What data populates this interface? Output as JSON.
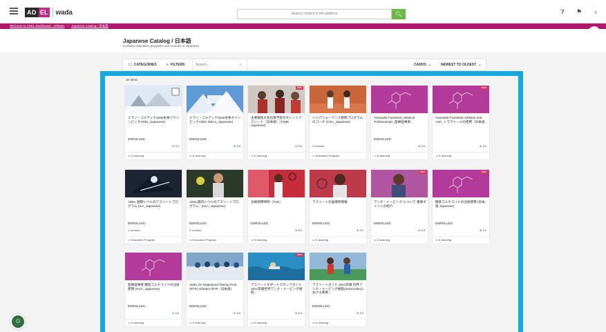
{
  "header": {
    "logo_adel_prefix": "AD",
    "logo_adel_suffix": "EL",
    "logo_wada": "wada",
    "search_placeholder": "Search content in the platform"
  },
  "breadcrumb": [
    "Welcome to ADEL Dashboard - Athletes",
    "Japanese Catalog / 日本語"
  ],
  "avatar_text": "GO",
  "page": {
    "title": "Japanese Catalog / 日本語",
    "subtitle": "Contains education programs and courses in Japanese"
  },
  "toolbar": {
    "categories": "CATEGORIES",
    "filters": "FILTERS",
    "search_placeholder": "Search...",
    "view": "CARDS",
    "sort": "NEWEST TO OLDEST"
  },
  "items_count": "16 Items",
  "colors": {
    "accent_blue": "#16a9e1",
    "brand_magenta": "#b0176e",
    "search_green": "#6bb944"
  },
  "cards": [
    {
      "title": "ミラノ・コルティナ2026冬季パラリンピックADEL (Japanese)",
      "status": "ENROLLED",
      "sub": "",
      "rating": "5.0",
      "type": "E-learning",
      "new": false,
      "thumb": "snow"
    },
    {
      "title": "ミラノ・コルティナ2026冬季オリンピックADEL (MiCo_Japanese)",
      "status": "ENROLLED",
      "sub": "",
      "rating": "5.0",
      "type": "E-learning",
      "new": false,
      "thumb": "mountain"
    },
    {
      "title": "主要競技大会出場予定のタレントアスリート（日本語）(TAME Japanese)",
      "status": "",
      "sub": "",
      "rating": "5.0",
      "type": "E-learning",
      "new": true,
      "thumb": "group"
    },
    {
      "title": "ハイパフォーマンス教育プログラムのコーチ (CGA_Japanese)",
      "status": "",
      "sub": "2 courses",
      "rating": "",
      "type": "Education Program",
      "new": false,
      "thumb": "tennis"
    },
    {
      "title": "Tramadol Factsheet_Medical Professionals_医療従事者...",
      "status": "ENROLLED",
      "sub": "",
      "rating": "5.0",
      "type": "E-learning",
      "new": false,
      "thumb": "molecule"
    },
    {
      "title": "Tramadol Factsheet Athletes and ASP_トラマドールの使用（日本語...",
      "status": "",
      "sub": "",
      "rating": "5.0",
      "type": "E-learning",
      "new": true,
      "thumb": "molecule"
    },
    {
      "title": "ADEL 国際レベルのアスリートプログラム (ILA_Japanese)",
      "status": "ENROLLED",
      "sub": "2 courses",
      "rating": "",
      "type": "Education Program",
      "new": false,
      "thumb": "ski"
    },
    {
      "title": "ADEL国内レベルのアスリートプログラム - (NLA_Japanese)",
      "status": "ENROLLED",
      "sub": "2 courses",
      "rating": "",
      "type": "Education Program",
      "new": false,
      "thumb": "athlete"
    },
    {
      "title": "治療使用特例（TUE）",
      "status": "ENROLLED",
      "sub": "",
      "rating": "5.0",
      "type": "E-learning",
      "new": false,
      "thumb": "tennis2"
    },
    {
      "title": "アスリートの居場所情報",
      "status": "ENROLLED",
      "sub": "",
      "rating": "5.0",
      "type": "E-learning",
      "new": false,
      "thumb": "woman"
    },
    {
      "title": "アンチ・ドーピング について 重要ポイントの紹介",
      "status": "ENROLLED",
      "sub": "",
      "rating": "5.0",
      "type": "E-learning",
      "new": true,
      "thumb": "portrait"
    },
    {
      "title": "糖質コルチコイドの注射使用 (日本語 Japanese)",
      "status": "ENROLLED",
      "sub": "",
      "rating": "5.0",
      "type": "E-learning",
      "new": true,
      "thumb": "molecule"
    },
    {
      "title": "医療従事者 糖質コルチコイドの注射使用 (GCC_Japanese)",
      "status": "ENROLLED",
      "sub": "",
      "rating": "5.0",
      "type": "E-learning",
      "new": false,
      "thumb": "molecule"
    },
    {
      "title": "ADEL for Registered Testing Pool (RTP) Athletes (RTP - 日本語)",
      "status": "ENROLLED",
      "sub": "",
      "rating": "5.0",
      "type": "E-learning",
      "new": false,
      "thumb": "crowd"
    },
    {
      "title": "アスリートサポートスタッフガイド 2021年版世界アンチ・ドーピング規程...",
      "status": "",
      "sub": "",
      "rating": "5.0",
      "type": "E-learning",
      "new": true,
      "thumb": "swim"
    },
    {
      "title": "アスリートガイド 2021年版 世界アンチ・ドーピング規程(2021Code)における重要...",
      "status": "ENROLLED",
      "sub": "",
      "rating": "5.0",
      "type": "E-learning",
      "new": false,
      "thumb": "run"
    }
  ]
}
